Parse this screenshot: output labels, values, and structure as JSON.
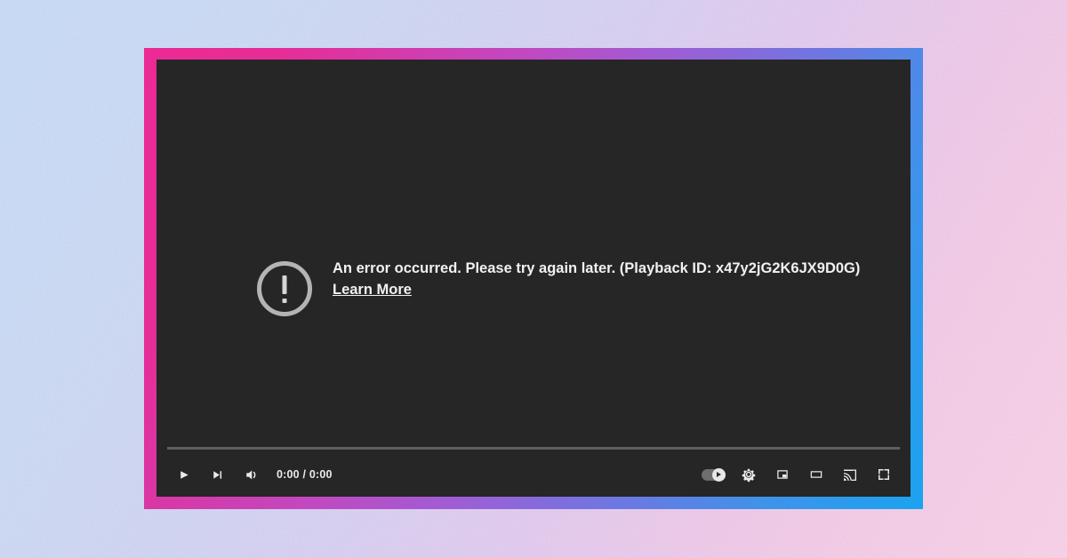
{
  "background": {
    "description": "grainy diagonal gradient backdrop",
    "color_top_left": "#bfd4f2",
    "color_mid": "#d2c7ec",
    "color_bottom_right": "#f4c9e2"
  },
  "frame": {
    "border_color_start": "#ec2a95",
    "border_color_mid": "#9b5fd6",
    "border_color_end": "#1aa3f0"
  },
  "player": {
    "background_color": "#262626",
    "error": {
      "icon": "error-exclamation-circle-icon",
      "message": "An error occurred. Please try again later. (Playback ID: x47y2jG2K6JX9D0G)",
      "playback_id": "x47y2jG2K6JX9D0G",
      "learn_more_label": "Learn More"
    },
    "controls": {
      "progress_percent": 0,
      "time_display": "0:00 / 0:00",
      "left_buttons": [
        {
          "name": "play-button",
          "icon": "play-icon",
          "label": "Play"
        },
        {
          "name": "next-button",
          "icon": "next-track-icon",
          "label": "Next"
        },
        {
          "name": "volume-button",
          "icon": "volume-icon",
          "label": "Mute"
        }
      ],
      "autoplay": {
        "name": "autoplay-toggle",
        "label": "Autoplay",
        "state": "on"
      },
      "right_buttons": [
        {
          "name": "settings-button",
          "icon": "gear-icon",
          "label": "Settings"
        },
        {
          "name": "miniplayer-button",
          "icon": "miniplayer-icon",
          "label": "Miniplayer"
        },
        {
          "name": "theater-button",
          "icon": "theater-mode-icon",
          "label": "Theater mode"
        },
        {
          "name": "cast-button",
          "icon": "cast-icon",
          "label": "Play on TV"
        },
        {
          "name": "fullscreen-button",
          "icon": "fullscreen-icon",
          "label": "Full screen"
        }
      ]
    }
  }
}
